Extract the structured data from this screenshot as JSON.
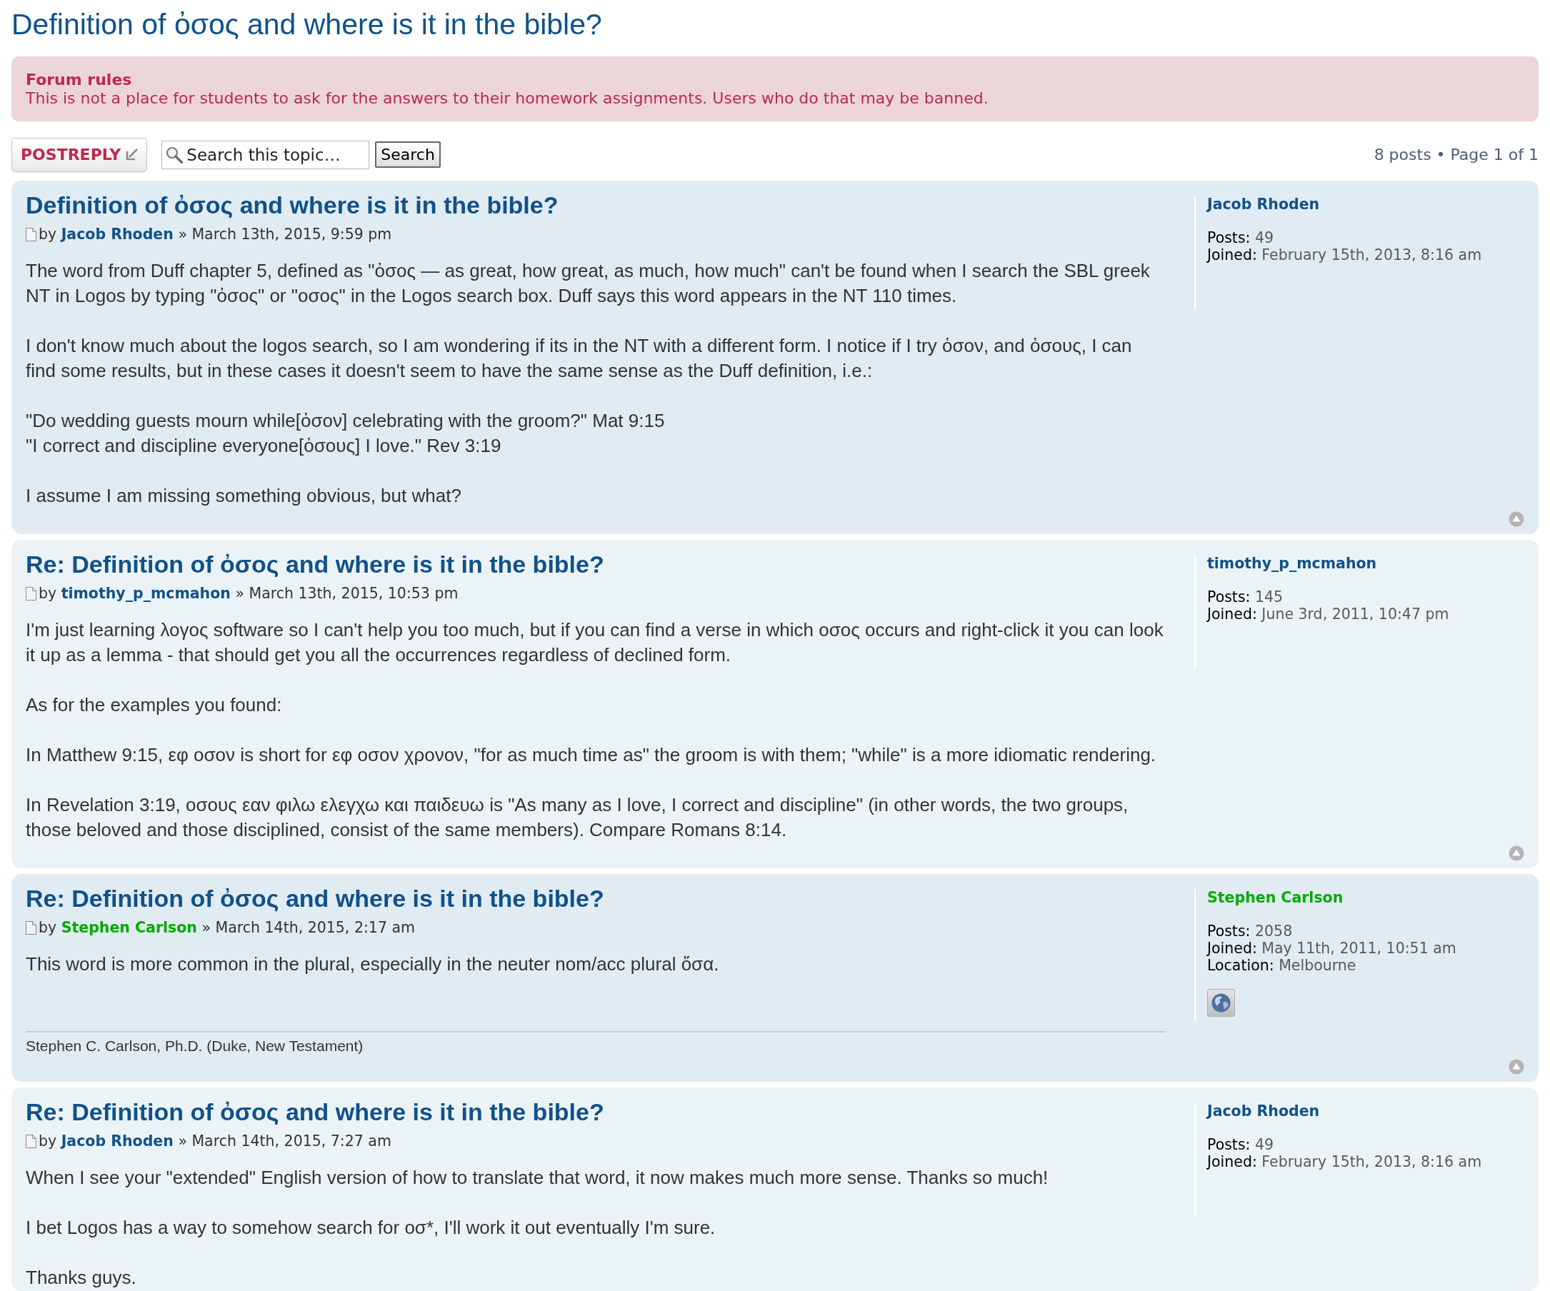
{
  "topic_title": "Definition of ὀσος and where is it in the bible?",
  "forum_rules": {
    "title": "Forum rules",
    "text": "This is not a place for students to ask for the answers to their homework assignments. Users who do that may be banned."
  },
  "actions": {
    "post_reply": "POSTREPLY",
    "search": {
      "placeholder": "Search this topic…",
      "button": "Search"
    },
    "pagination": "8 posts • Page 1 of 1"
  },
  "posts": [
    {
      "title": "Definition of ὀσος and where is it in the bible?",
      "by": "by",
      "author": {
        "name": "Jacob Rhoden",
        "color": "#105289"
      },
      "date": "» March 13th, 2015, 9:59 pm",
      "paragraphs": [
        "The word from Duff chapter 5, defined as \"ὀσος — as great, how great, as much, how much\" can't be found when I search the SBL greek NT in Logos by typing \"ὀσος\" or \"οσος\" in the Logos search box. Duff says this word appears in the NT 110 times.",
        "I don't know much about the logos search, so I am wondering if its in the NT with a different form. I notice if I try ὀσον, and ὀσους, I can find some results, but in these cases it doesn't seem to have the same sense as the Duff definition, i.e.:",
        "\"Do wedding guests mourn while[ὀσον] celebrating with the groom?\" Mat 9:15\n\"I correct and discipline everyone[ὀσους] I love.\" Rev 3:19",
        "I assume I am missing something obvious, but what?"
      ],
      "profile_name": {
        "name": "Jacob Rhoden",
        "color": "#105289"
      },
      "profile": [
        {
          "label": "Posts:",
          "value": "49"
        },
        {
          "label": "Joined:",
          "value": "February 15th, 2013, 8:16 am"
        }
      ],
      "website_link": false,
      "top_link": true
    },
    {
      "title": "Re: Definition of ὀσος and where is it in the bible?",
      "by": "by",
      "author": {
        "name": "timothy_p_mcmahon",
        "color": "#105289"
      },
      "date": "» March 13th, 2015, 10:53 pm",
      "paragraphs": [
        "I'm just learning λογος software so I can't help you too much, but if you can find a verse in which οσος occurs and right-click it you can look it up as a lemma - that should get you all the occurrences regardless of declined form.",
        "As for the examples you found:",
        "In Matthew 9:15, εφ οσον is short for εφ οσον χρονον, \"for as much time as\" the groom is with them; \"while\" is a more idiomatic rendering.",
        "In Revelation 3:19, οσους εαν φιλω ελεγχω και παιδευω is \"As many as I love, I correct and discipline\" (in other words, the two groups, those beloved and those disciplined, consist of the same members). Compare Romans 8:14."
      ],
      "profile_name": {
        "name": "timothy_p_mcmahon",
        "color": "#105289"
      },
      "profile": [
        {
          "label": "Posts:",
          "value": "145"
        },
        {
          "label": "Joined:",
          "value": "June 3rd, 2011, 10:47 pm"
        }
      ],
      "website_link": false,
      "top_link": true
    },
    {
      "title": "Re: Definition of ὀσος and where is it in the bible?",
      "by": "by",
      "author": {
        "name": "Stephen Carlson",
        "color": "#00aa00"
      },
      "date": "» March 14th, 2015, 2:17 am",
      "paragraphs": [
        "This word is more common in the plural, especially in the neuter nom/acc plural ὅσα."
      ],
      "signature": "Stephen C. Carlson, Ph.D. (Duke, New Testament)",
      "profile_name": {
        "name": "Stephen Carlson",
        "color": "#00aa00"
      },
      "profile": [
        {
          "label": "Posts:",
          "value": "2058"
        },
        {
          "label": "Joined:",
          "value": "May 11th, 2011, 10:51 am"
        },
        {
          "label": "Location:",
          "value": "Melbourne"
        }
      ],
      "website_link": true,
      "top_link": true
    },
    {
      "title": "Re: Definition of ὀσος and where is it in the bible?",
      "by": "by",
      "author": {
        "name": "Jacob Rhoden",
        "color": "#105289"
      },
      "date": "» March 14th, 2015, 7:27 am",
      "paragraphs": [
        "When I see your \"extended\" English version of how to translate that word, it now makes much more sense. Thanks so much!",
        "I bet Logos has a way to somehow search for οσ*, I'll work it out eventually I'm sure.",
        "Thanks guys."
      ],
      "profile_name": {
        "name": "Jacob Rhoden",
        "color": "#105289"
      },
      "profile": [
        {
          "label": "Posts:",
          "value": "49"
        },
        {
          "label": "Joined:",
          "value": "February 15th, 2013, 8:16 am"
        }
      ],
      "website_link": false,
      "top_link": false
    }
  ]
}
